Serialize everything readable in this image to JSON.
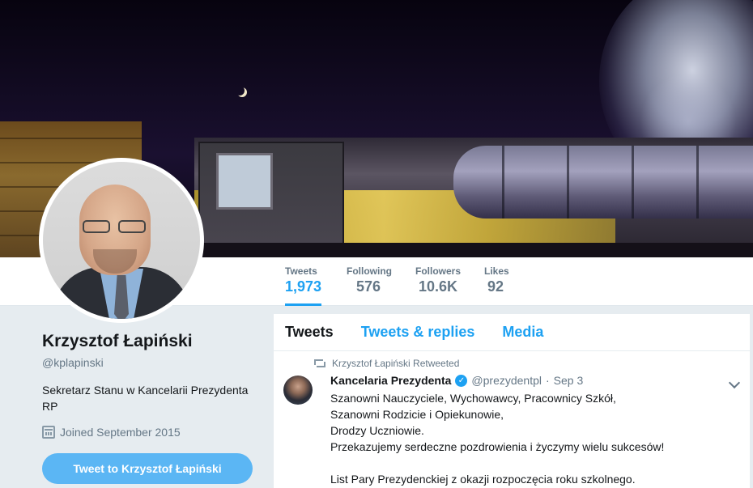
{
  "profile": {
    "name": "Krzysztof Łapiński",
    "handle": "@kplapinski",
    "bio": "Sekretarz Stanu w Kancelarii Prezydenta RP",
    "joined": "Joined September 2015",
    "tweet_to_button": "Tweet to Krzysztof Łapiński"
  },
  "stats": [
    {
      "label": "Tweets",
      "value": "1,973"
    },
    {
      "label": "Following",
      "value": "576"
    },
    {
      "label": "Followers",
      "value": "10.6K"
    },
    {
      "label": "Likes",
      "value": "92"
    }
  ],
  "timeline": {
    "tabs": [
      "Tweets",
      "Tweets & replies",
      "Media"
    ],
    "active_tab": "Tweets",
    "tweet": {
      "retweet_context": "Krzysztof Łapiński Retweeted",
      "author_name": "Kancelaria Prezydenta",
      "author_handle": "@prezydentpl",
      "separator": "·",
      "date": "Sep 3",
      "lines": [
        "Szanowni Nauczyciele, Wychowawcy, Pracownicy Szkół,",
        "Szanowni Rodzicie i Opiekunowie,",
        "Drodzy Uczniowie.",
        "Przekazujemy serdeczne pozdrowienia i życzymy wielu sukcesów!",
        "",
        "List Pary Prezydenckiej z okazji rozpoczęcia roku szkolnego."
      ]
    }
  },
  "colors": {
    "accent": "#1da1f2",
    "button": "#5bb6f4",
    "muted": "#657786",
    "background": "#e6ecf0"
  },
  "icons": {
    "calendar": "calendar-icon",
    "retweet": "retweet-icon",
    "verified": "verified-badge-icon",
    "caret": "chevron-down-icon"
  }
}
